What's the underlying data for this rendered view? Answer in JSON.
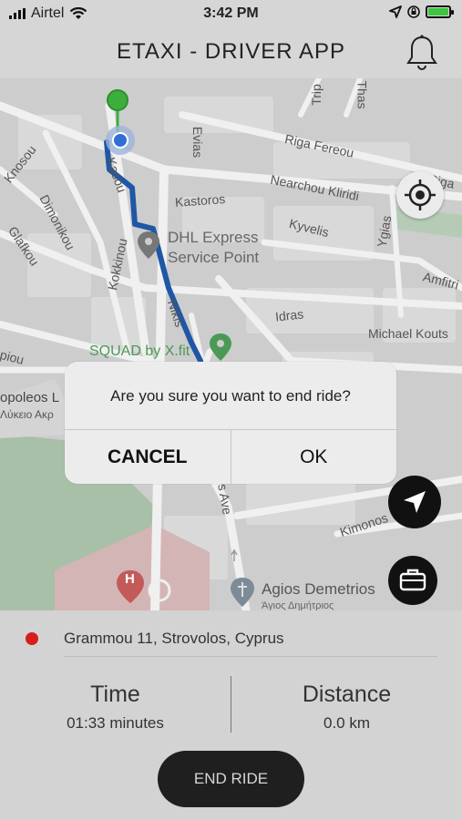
{
  "status_bar": {
    "carrier": "Airtel",
    "time": "3:42 PM"
  },
  "header": {
    "title": "ETAXI - DRIVER APP",
    "bell_icon": "bell-icon"
  },
  "map": {
    "streets": [
      "Knosou",
      "Kasou",
      "Evias",
      "Trip",
      "Thas",
      "Riga Fereou",
      "Riga",
      "Nearchou Kliridi",
      "Kastoros",
      "Kyvelis",
      "Ygias",
      "Amfitri",
      "Dimonikou",
      "Glafkou",
      "Kokkinou",
      "Nikis",
      "Idras",
      "Michael Kouts",
      "piou",
      "opoleos L",
      "Λύκειο Ακρ",
      "s Ave",
      "Kimonos"
    ],
    "poi_dhl": [
      "DHL Express",
      "Service Point"
    ],
    "poi_squad": "SQUAD by X.fit",
    "poi_church": "Agios Demetrios",
    "poi_church_sub": "Άγιος Δημήτριος",
    "poi_hospital": "H",
    "route_color": "#1f57a6",
    "origin_color": "#3cae3c",
    "driver_color": "#2f6fd6"
  },
  "dialog": {
    "message": "Are you sure you want to end ride?",
    "cancel": "CANCEL",
    "ok": "OK"
  },
  "ride": {
    "address": "Grammou 11, Strovolos, Cyprus",
    "time_label": "Time",
    "time_value": "01:33 minutes",
    "distance_label": "Distance",
    "distance_value": "0.0 km",
    "end_ride": "END RIDE"
  }
}
